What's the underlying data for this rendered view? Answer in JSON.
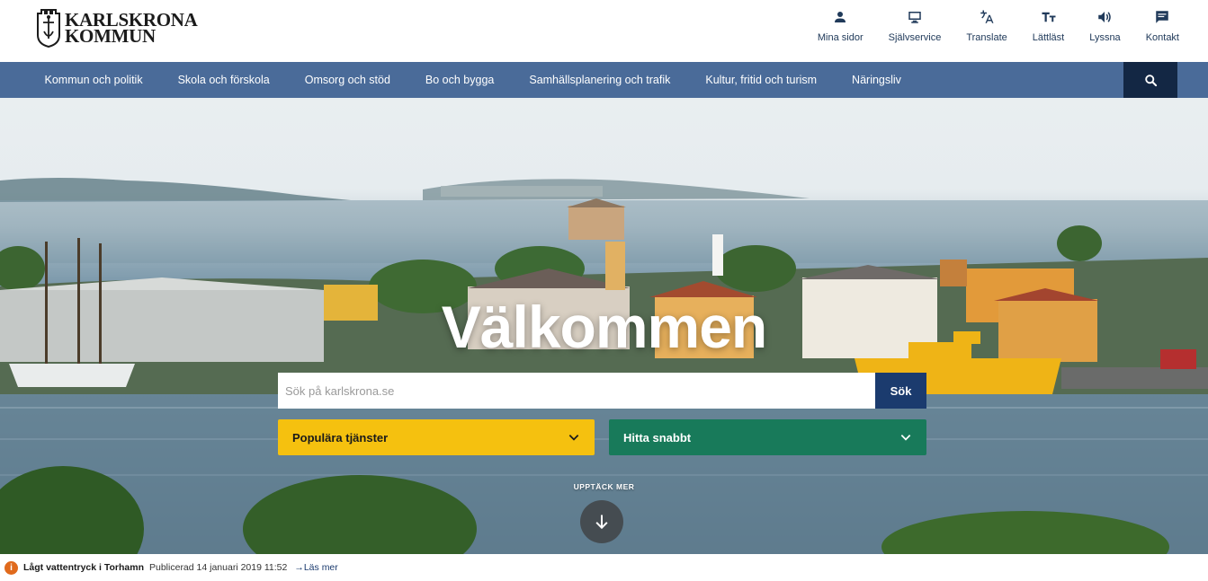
{
  "header": {
    "logo_line1": "KARLSKRONA",
    "logo_line2": "KOMMUN",
    "tools": [
      {
        "label": "Mina sidor",
        "icon": "person-icon"
      },
      {
        "label": "Självservice",
        "icon": "monitor-icon"
      },
      {
        "label": "Translate",
        "icon": "translate-icon"
      },
      {
        "label": "Lättläst",
        "icon": "text-size-icon"
      },
      {
        "label": "Lyssna",
        "icon": "speaker-icon"
      },
      {
        "label": "Kontakt",
        "icon": "chat-icon"
      }
    ]
  },
  "nav": {
    "items": [
      "Kommun och politik",
      "Skola och förskola",
      "Omsorg och stöd",
      "Bo och bygga",
      "Samhällsplanering och trafik",
      "Kultur, fritid och turism",
      "Näringsliv"
    ],
    "search_icon": "search-icon"
  },
  "hero": {
    "title": "Välkommen",
    "search_placeholder": "Sök på karlskrona.se",
    "search_value": "",
    "search_button": "Sök",
    "popular_label": "Populära tjänster",
    "quick_label": "Hitta snabbt",
    "discover_label": "UPPTÄCK MER"
  },
  "alert": {
    "icon_glyph": "i",
    "title": "Lågt vattentryck i Torhamn",
    "published": "Publicerad 14 januari 2019 11:52",
    "link": "Läs mer"
  },
  "colors": {
    "nav_bg": "#4a6b99",
    "nav_search_bg": "#132744",
    "search_button_bg": "#1b3b6e",
    "popular_bg": "#f5c10f",
    "quick_bg": "#187a5a",
    "alert_icon": "#e06a1c"
  }
}
